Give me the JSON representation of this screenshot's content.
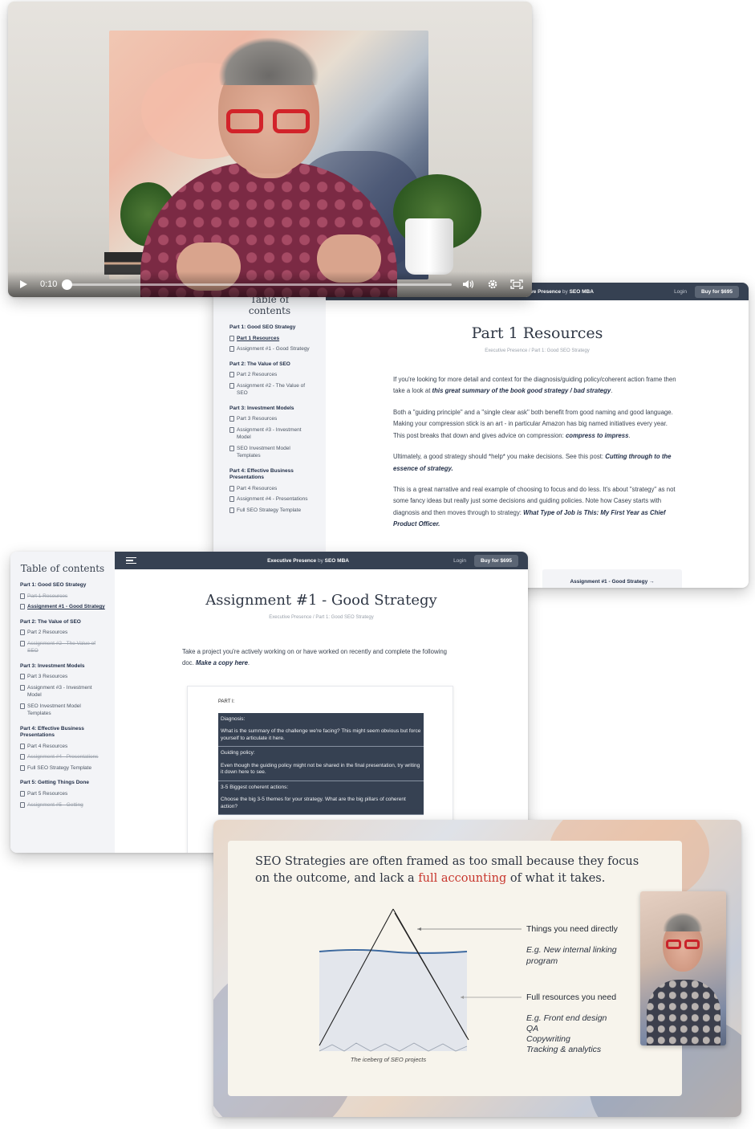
{
  "video": {
    "time": "0:10",
    "progress_fraction": 0.0,
    "icons": [
      "play-icon",
      "volume-icon",
      "settings-gear-icon",
      "fullscreen-icon"
    ]
  },
  "part1_page": {
    "toc_title": "Table of contents",
    "brand": "Executive Presence",
    "brand_by": "by",
    "brand_org": "SEO MBA",
    "login": "Login",
    "buy": "Buy for $695",
    "sections": [
      {
        "title": "Part 1: Good SEO Strategy",
        "items": [
          {
            "label": "Part 1 Resources",
            "state": "active"
          },
          {
            "label": "Assignment #1 - Good Strategy",
            "state": "normal"
          }
        ]
      },
      {
        "title": "Part 2: The Value of SEO",
        "items": [
          {
            "label": "Part 2 Resources",
            "state": "normal"
          },
          {
            "label": "Assignment #2 - The Value of SEO",
            "state": "normal"
          }
        ]
      },
      {
        "title": "Part 3: Investment Models",
        "items": [
          {
            "label": "Part 3 Resources",
            "state": "normal"
          },
          {
            "label": "Assignment #3 - Investment Model",
            "state": "normal"
          },
          {
            "label": "SEO Investment Model Templates",
            "state": "normal"
          }
        ]
      },
      {
        "title": "Part 4: Effective Business Presentations",
        "items": [
          {
            "label": "Part 4 Resources",
            "state": "normal"
          },
          {
            "label": "Assignment #4 - Presentations",
            "state": "normal"
          },
          {
            "label": "Full SEO Strategy Template",
            "state": "normal"
          }
        ]
      }
    ],
    "heading": "Part 1 Resources",
    "crumb_1": "Executive Presence",
    "crumb_sep": "/",
    "crumb_2": "Part 1: Good SEO Strategy",
    "p1_text": "If you're looking for more detail and context for the diagnosis/guiding policy/coherent action frame then take a look at ",
    "p1_link": "this great summary of the book good strategy / bad strategy",
    "p1_end": ".",
    "p2_text": "Both a \"guiding principle\" and a \"single clear ask\" both benefit from good naming and good language. Making your compression stick is an art - in particular Amazon has big named initiatives every year. This post breaks that down and gives advice on compression: ",
    "p2_link": "compress to impress",
    "p2_end": ".",
    "p3_text": "Ultimately, a good strategy should *help* you make decisions. See this post: ",
    "p3_link": "Cutting through to the essence of strategy.",
    "p4_text": "This is a great narrative and real example of choosing to focus and do less. It's about \"strategy\" as not some fancy ideas but really just some decisions and guiding policies. Note how Casey starts with diagnosis and then moves through to strategy: ",
    "p4_link": "What Type of Job is This: My First Year as Chief Product Officer.",
    "next": "Assignment #1 - Good Strategy →"
  },
  "assign_page": {
    "toc_title": "Table of contents",
    "brand": "Executive Presence",
    "brand_by": "by",
    "brand_org": "SEO MBA",
    "login": "Login",
    "buy": "Buy for $695",
    "sections": [
      {
        "title": "Part 1: Good SEO Strategy",
        "items": [
          {
            "label": "Part 1 Resources",
            "state": "done"
          },
          {
            "label": "Assignment #1 - Good Strategy",
            "state": "active"
          }
        ]
      },
      {
        "title": "Part 2: The Value of SEO",
        "items": [
          {
            "label": "Part 2 Resources",
            "state": "normal"
          },
          {
            "label": "Assignment #2 - The Value of SEO",
            "state": "done"
          }
        ]
      },
      {
        "title": "Part 3: Investment Models",
        "items": [
          {
            "label": "Part 3 Resources",
            "state": "normal"
          },
          {
            "label": "Assignment #3 - Investment Model",
            "state": "normal"
          },
          {
            "label": "SEO Investment Model Templates",
            "state": "normal"
          }
        ]
      },
      {
        "title": "Part 4: Effective Business Presentations",
        "items": [
          {
            "label": "Part 4 Resources",
            "state": "normal"
          },
          {
            "label": "Assignment #4 - Presentations",
            "state": "done"
          },
          {
            "label": "Full SEO Strategy Template",
            "state": "normal"
          }
        ]
      },
      {
        "title": "Part 5: Getting Things Done",
        "items": [
          {
            "label": "Part 5 Resources",
            "state": "normal"
          },
          {
            "label": "Assignment #5 - Getting",
            "state": "done"
          }
        ]
      }
    ],
    "heading": "Assignment #1 - Good Strategy",
    "crumb_1": "Executive Presence",
    "crumb_sep": "/",
    "crumb_2": "Part 1: Good SEO Strategy",
    "intro_text": "Take a project you're actively working on or have worked on recently and complete the following doc. ",
    "intro_link": "Make a copy here",
    "intro_end": ".",
    "doc_part": "PART I:",
    "doc_rows": [
      {
        "label": "Diagnosis:",
        "text": "What is the summary of the challenge we're facing? This might seem obvious but force yourself to articulate it here."
      },
      {
        "label": "Guiding policy:",
        "text": "Even though the guiding policy might not be shared in the final presentation, try writing it down here to see."
      },
      {
        "label": "3-5 Biggest coherent actions:",
        "text": "Choose the big 3-5 themes for your strategy. What are the big pillars of coherent action?"
      }
    ]
  },
  "slide": {
    "title_a": "SEO Strategies are often framed as too small because they focus on the outcome, and lack a ",
    "title_hl": "full accounting",
    "title_b": " of what it takes.",
    "label_top": "Things you need directly",
    "label_top_ex": "E.g. New internal linking program",
    "label_bottom": "Full resources you need",
    "label_bottom_ex_1": "E.g. Front end design",
    "label_bottom_ex_2": "QA",
    "label_bottom_ex_3": "Copywriting",
    "label_bottom_ex_4": "Tracking & analytics",
    "caption": "The iceberg of SEO projects",
    "colors": {
      "highlight": "#c7352c",
      "water_line": "#3e6aa0"
    }
  }
}
